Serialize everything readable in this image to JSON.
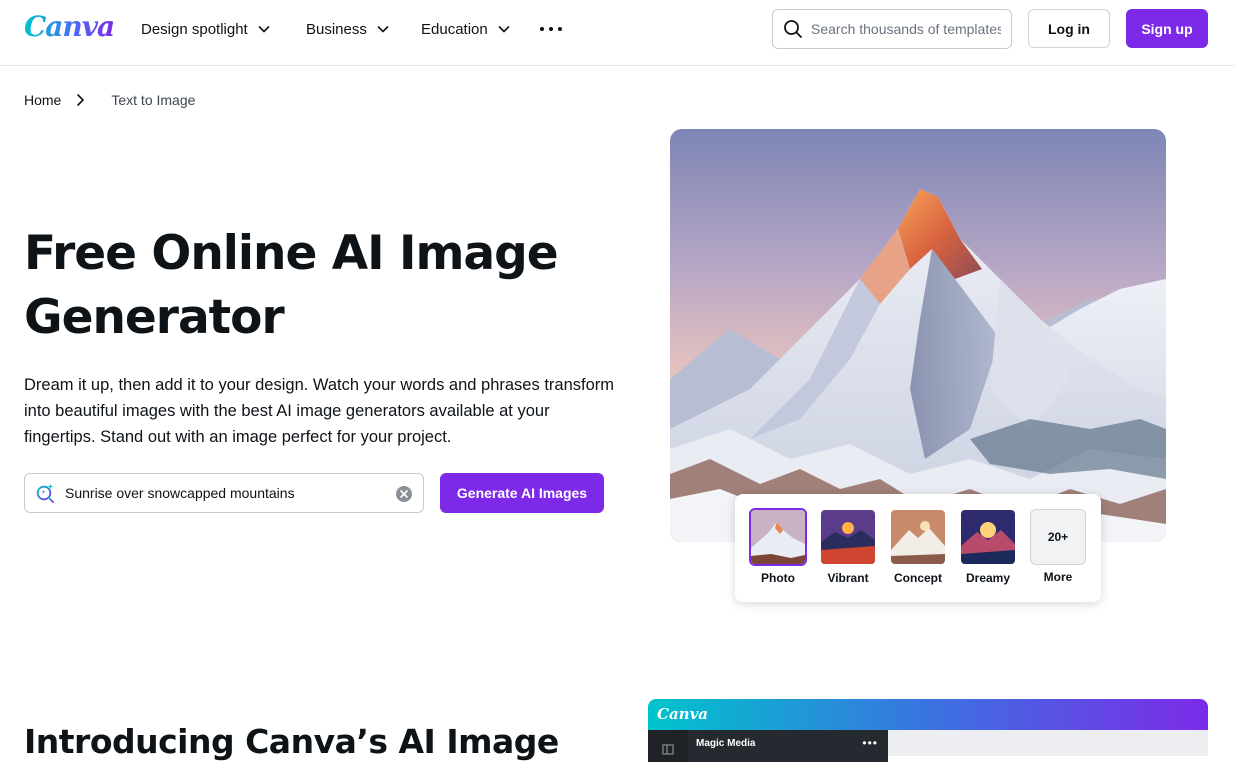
{
  "header": {
    "logo": "Canva",
    "nav": [
      {
        "label": "Design spotlight"
      },
      {
        "label": "Business"
      },
      {
        "label": "Education"
      }
    ],
    "more_icon": "more-horizontal-icon",
    "search": {
      "placeholder": "Search thousands of templates",
      "icon": "search-icon"
    },
    "login_label": "Log in",
    "signup_label": "Sign up"
  },
  "breadcrumb": {
    "home": "Home",
    "current": "Text to Image",
    "separator_icon": "chevron-right-icon"
  },
  "hero": {
    "title": "Free Online AI Image Generator",
    "description": "Dream it up, then add it to your design. Watch your words and phrases transform into beautiful images with the best AI image generators available at your fingertips. Stand out with an image perfect for your project.",
    "prompt_value": "Sunrise over snowcapped mountains",
    "prompt_icon": "magic-search-icon",
    "clear_icon": "clear-icon",
    "generate_label": "Generate AI Images"
  },
  "styles": {
    "items": [
      {
        "label": "Photo",
        "selected": true
      },
      {
        "label": "Vibrant",
        "selected": false
      },
      {
        "label": "Concept",
        "selected": false
      },
      {
        "label": "Dreamy",
        "selected": false
      }
    ],
    "more_count": "20+",
    "more_label": "More"
  },
  "section2": {
    "title": "Introducing Canva’s AI Image"
  },
  "preview": {
    "logo": "Canva",
    "panel_title": "Magic Media",
    "panel_menu": "•••"
  },
  "colors": {
    "brand_purple": "#7d2ae8",
    "brand_teal": "#00c4cc",
    "text": "#0e1318"
  }
}
